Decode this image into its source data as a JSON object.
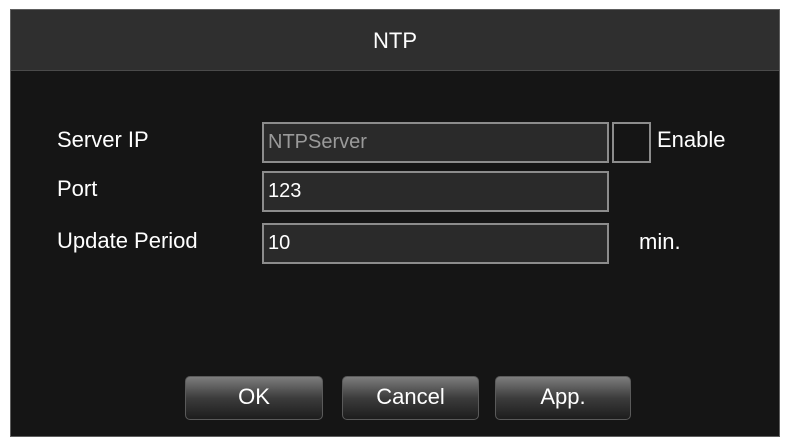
{
  "dialog": {
    "title": "NTP"
  },
  "form": {
    "server_ip_label": "Server IP",
    "server_ip_value": "NTPServer",
    "enable_label": "Enable",
    "enable_checked": false,
    "port_label": "Port",
    "port_value": "123",
    "update_period_label": "Update Period",
    "update_period_value": "10",
    "update_period_unit": "min."
  },
  "buttons": {
    "ok_label": "OK",
    "cancel_label": "Cancel",
    "apply_label": "App."
  },
  "colors": {
    "dialog_background": "#151515",
    "titlebar_background": "#2f2f2f",
    "field_border": "#8c8c8c",
    "text": "#ffffff",
    "disabled_text": "#9a9a9a"
  }
}
